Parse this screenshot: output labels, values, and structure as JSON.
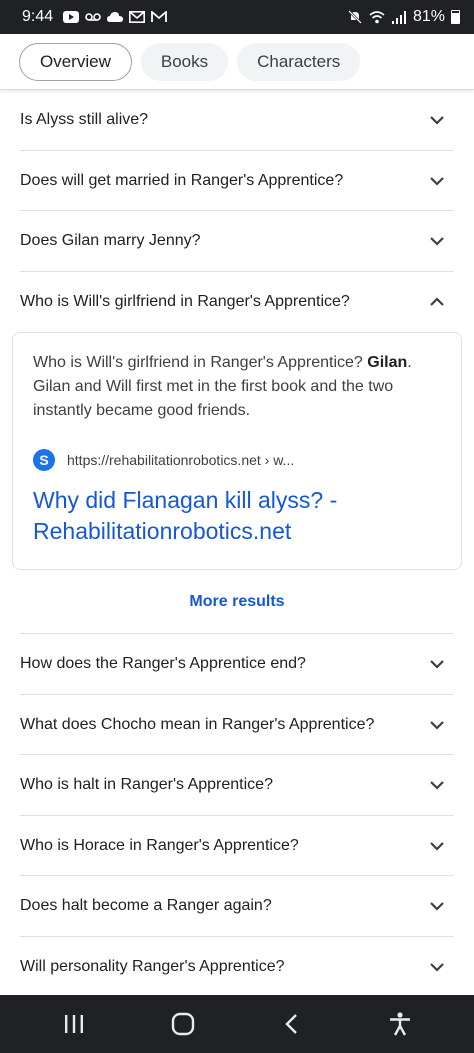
{
  "status_bar": {
    "time": "9:44",
    "battery_text": "81%",
    "battery_level": 0.81,
    "icons": [
      "youtube-icon",
      "voicemail-icon",
      "cloud-icon",
      "mail-icon",
      "gmail-icon",
      "mute-icon",
      "wifi-icon",
      "signal-icon",
      "battery-icon"
    ]
  },
  "tabs": [
    {
      "label": "Overview",
      "active": true
    },
    {
      "label": "Books",
      "active": false
    },
    {
      "label": "Characters",
      "active": false
    }
  ],
  "faq_top": [
    {
      "question": "Is Alyss still alive?"
    },
    {
      "question": "Does will get married in Ranger's Apprentice?"
    },
    {
      "question": "Does Gilan marry Jenny?"
    }
  ],
  "expanded": {
    "question": "Who is Will's girlfriend in Ranger's Apprentice?",
    "answer_lead": "Who is Will's girlfriend in Ranger's Apprentice? ",
    "answer_bold": "Gilan",
    "answer_rest": ". Gilan and Will first met in the first book and the two instantly became good friends.",
    "source_letter": "S",
    "source_url": "https://rehabilitationrobotics.net › w...",
    "source_title": "Why did Flanagan kill alyss? - Rehabilitationrobotics.net"
  },
  "more_results_label": "More results",
  "faq_bottom": [
    {
      "question": "How does the Ranger's Apprentice end?"
    },
    {
      "question": "What does Chocho mean in Ranger's Apprentice?"
    },
    {
      "question": "Who is halt in Ranger's Apprentice?"
    },
    {
      "question": "Who is Horace in Ranger's Apprentice?"
    },
    {
      "question": "Does halt become a Ranger again?"
    },
    {
      "question": "Will personality Ranger's Apprentice?"
    }
  ],
  "colors": {
    "link": "#1558d6",
    "status_bar_bg": "#202124",
    "nav_bar_bg": "#202124"
  }
}
